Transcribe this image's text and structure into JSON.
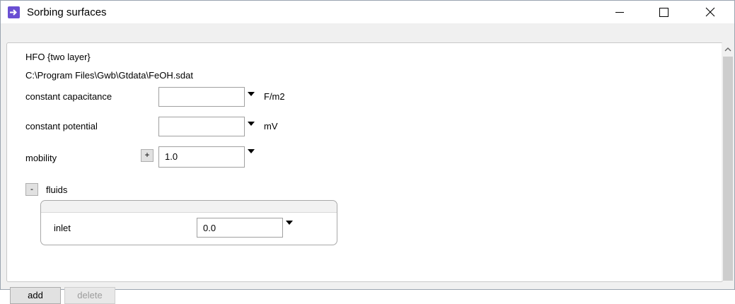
{
  "window": {
    "title": "Sorbing surfaces"
  },
  "surface": {
    "name": "HFO {two layer}",
    "path": "C:\\Program Files\\Gwb\\Gtdata\\FeOH.sdat"
  },
  "fields": {
    "capacitance": {
      "label": "constant capacitance",
      "value": "",
      "unit": "F/m2"
    },
    "potential": {
      "label": "constant potential",
      "value": "",
      "unit": "mV"
    },
    "mobility": {
      "label": "mobility",
      "value": "1.0",
      "toggle": "+"
    }
  },
  "fluids": {
    "toggle": "-",
    "label": "fluids",
    "inlet": {
      "label": "inlet",
      "value": "0.0"
    }
  },
  "buttons": {
    "add": "add",
    "delete": "delete"
  },
  "icons": {
    "app": "arrow-right-icon",
    "minimize": "minimize-icon",
    "maximize": "maximize-icon",
    "close": "close-icon",
    "dropdown": "triangle-down-icon",
    "scroll_up": "chevron-up-icon"
  },
  "colors": {
    "app_icon": "#6a4fd3",
    "panel_bg": "#ffffff",
    "window_bg": "#f0f0f0"
  }
}
